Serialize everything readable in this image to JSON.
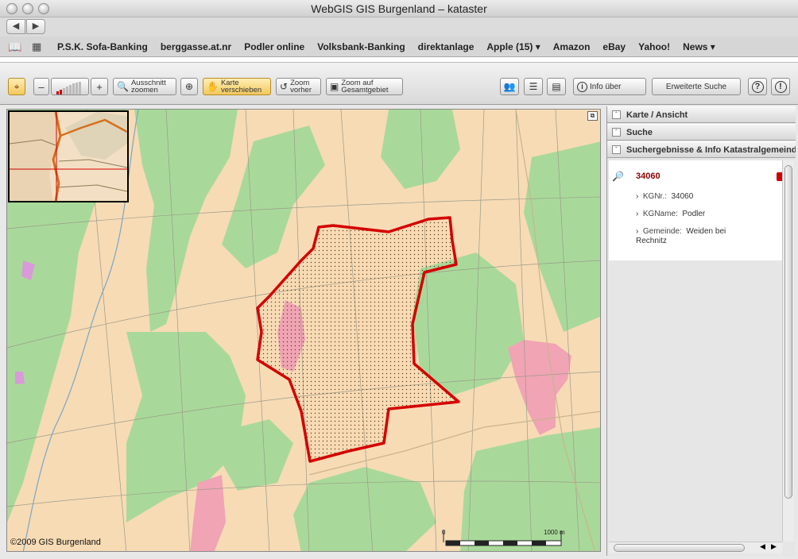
{
  "window": {
    "title": "WebGIS GIS Burgenland – kataster"
  },
  "nav": {
    "back_glyph": "◀",
    "forward_glyph": "▶"
  },
  "bookmarks": [
    "P.S.K. Sofa-Banking",
    "berggasse.at.nr",
    "Podler online",
    "Volksbank-Banking",
    "direktanlage",
    "Apple (15) ▾",
    "Amazon",
    "eBay",
    "Yahoo!",
    "News ▾"
  ],
  "toolbar": {
    "zoom_minus": "–",
    "zoom_plus": "+",
    "ausschnitt_line1": "Ausschnitt",
    "ausschnitt_line2": "zoomen",
    "karte_line1": "Karte",
    "karte_line2": "verschieben",
    "zoom_vorher_line1": "Zoom",
    "zoom_vorher_line2": "vorher",
    "zoom_gesamt_line1": "Zoom auf",
    "zoom_gesamt_line2": "Gesamtgebiet",
    "info_label": "Info über",
    "erweiterte_suche_label": "Erweiterte Suche",
    "help_glyph": "?",
    "about_glyph": "!"
  },
  "map": {
    "copyright": "©2009 GIS Burgenland",
    "scale_start": "0",
    "scale_end": "1000 m",
    "colors": {
      "farmland": "#f7dbb5",
      "forest": "#a9d99a",
      "parcel_outline": "#d40000",
      "settlement": "#f0a4b4"
    }
  },
  "panel": {
    "sections": {
      "karte": "Karte / Ansicht",
      "suche": "Suche",
      "ergebnisse": "Suchergebnisse & Info Katastralgemeinde"
    },
    "result": {
      "title": "34060",
      "kgnr_label": "KGNr.:",
      "kgnr_value": "34060",
      "kgname_label": "KGName:",
      "kgname_value": "Podler",
      "gemeinde_label": "Gemeinde:",
      "gemeinde_value": "Weiden bei Rechnitz"
    }
  }
}
